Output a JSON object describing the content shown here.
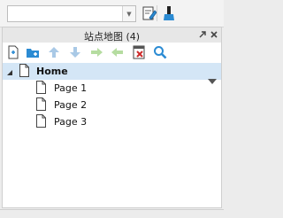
{
  "toolbar": {
    "combo_value": "",
    "icons": [
      "dropdown-arrow-icon",
      "page-edit-icon",
      "brush-icon"
    ]
  },
  "sitemap": {
    "title": "站点地图 (4)",
    "header_icons": [
      "pin-icon",
      "close-icon"
    ],
    "toolbar_icons": [
      "add-page-icon",
      "add-folder-icon",
      "move-up-icon",
      "move-down-icon",
      "indent-icon",
      "outdent-icon",
      "delete-page-icon",
      "search-icon"
    ],
    "tree": [
      {
        "label": "Home",
        "level": 0,
        "expanded": true,
        "selected": true
      },
      {
        "label": "Page 1",
        "level": 1
      },
      {
        "label": "Page 2",
        "level": 1
      },
      {
        "label": "Page 3",
        "level": 1
      }
    ]
  },
  "colors": {
    "selection": "#d4e6f6",
    "accent_blue": "#2b8bd3",
    "disabled_arrow": "#a9c9e6",
    "disabled_green": "#b5dca0",
    "delete_red": "#cc2a2a"
  }
}
